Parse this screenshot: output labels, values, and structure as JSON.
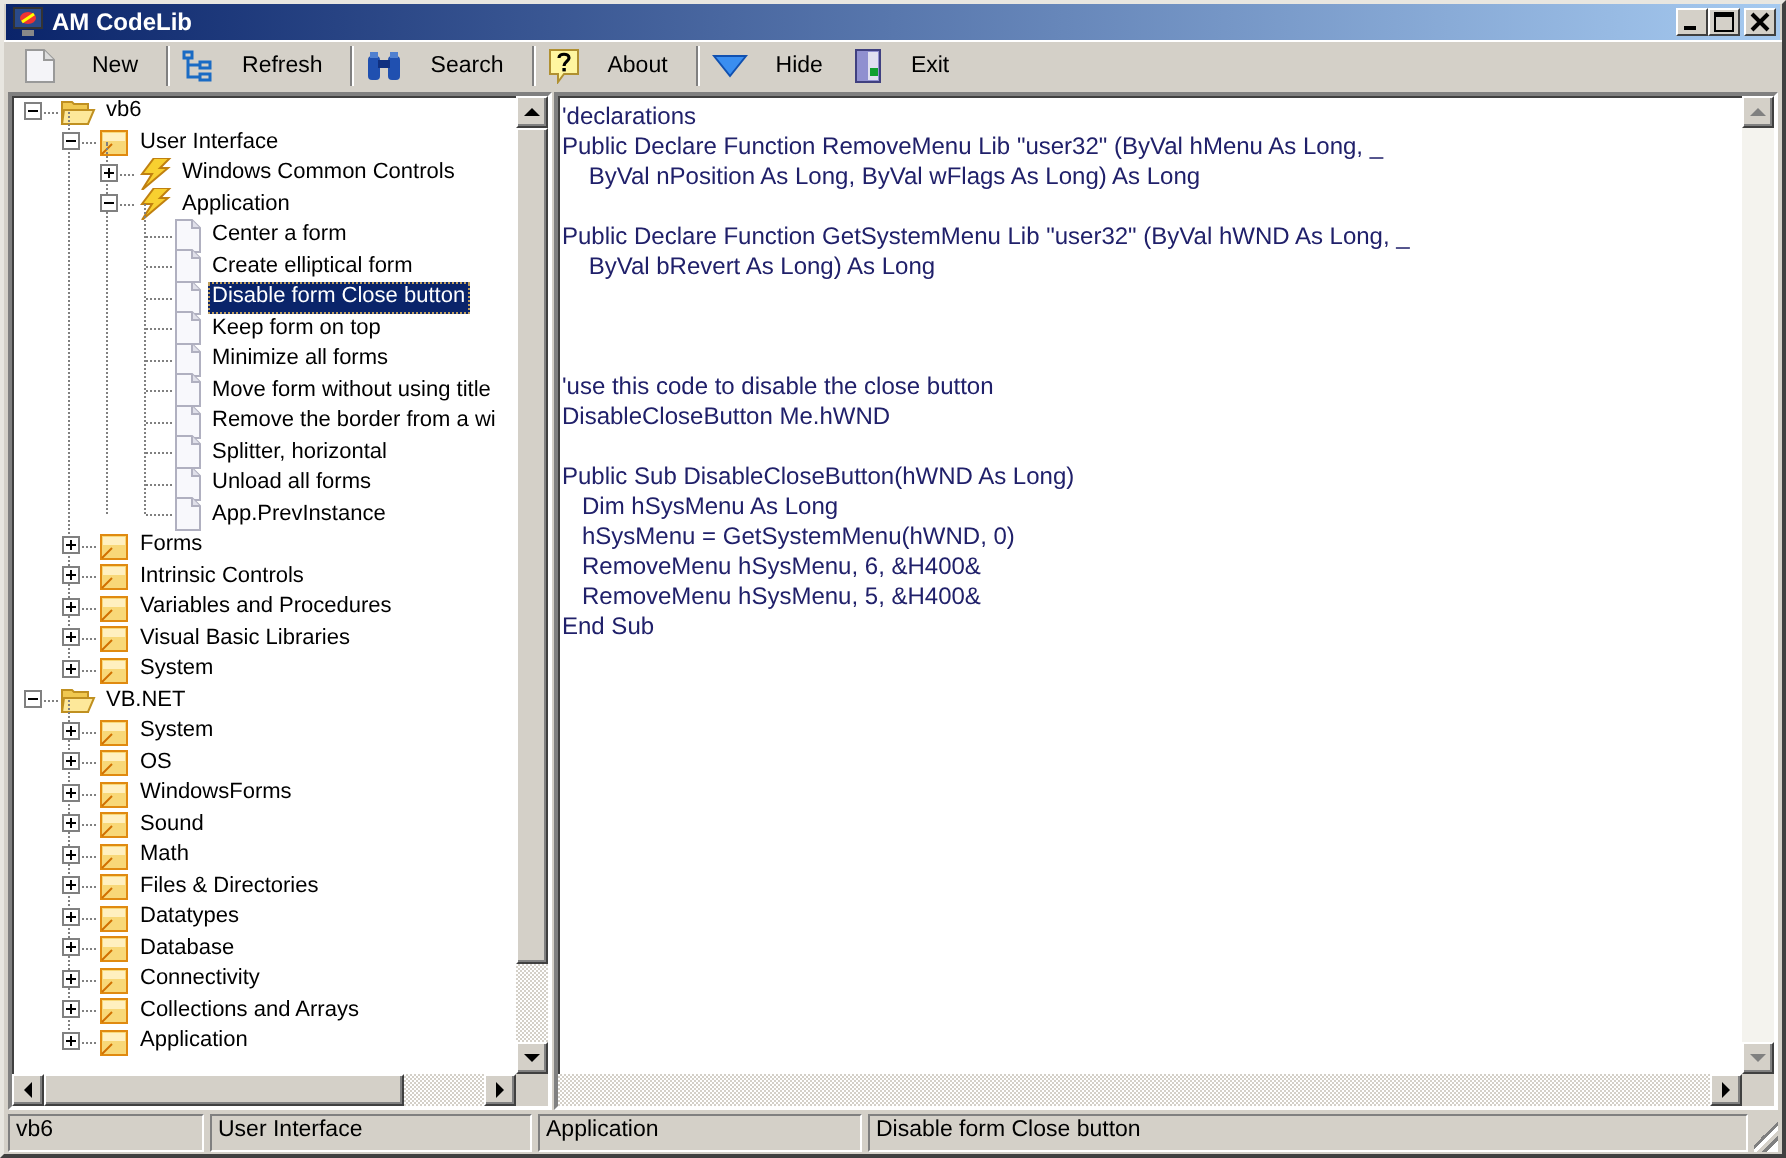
{
  "window": {
    "title": "AM CodeLib"
  },
  "toolbar": [
    [
      {
        "label": "New",
        "kind": "new"
      }
    ],
    [
      {
        "label": "Refresh",
        "kind": "refresh"
      }
    ],
    [
      {
        "label": "Search",
        "kind": "search"
      }
    ],
    [
      {
        "label": "About",
        "kind": "about"
      }
    ],
    [
      {
        "label": "Hide",
        "kind": "hide"
      },
      {
        "label": "Exit",
        "kind": "exit"
      }
    ]
  ],
  "tree": [
    {
      "label": "vb6",
      "kind": "root",
      "expanded": true,
      "selected": false,
      "children": [
        {
          "label": "User Interface",
          "kind": "category",
          "expanded": true,
          "selected": false,
          "children": [
            {
              "label": "Windows Common Controls",
              "kind": "group",
              "expanded": false,
              "selected": false
            },
            {
              "label": "Application",
              "kind": "group",
              "expanded": true,
              "selected": false,
              "children": [
                {
                  "label": "Center a form",
                  "kind": "document",
                  "selected": false
                },
                {
                  "label": "Create elliptical form",
                  "kind": "document",
                  "selected": false
                },
                {
                  "label": "Disable form Close button",
                  "kind": "document",
                  "selected": true
                },
                {
                  "label": "Keep form on top",
                  "kind": "document",
                  "selected": false
                },
                {
                  "label": "Minimize all forms",
                  "kind": "document",
                  "selected": false
                },
                {
                  "label": "Move form without using title",
                  "kind": "document",
                  "selected": false
                },
                {
                  "label": "Remove the border from a wi",
                  "kind": "document",
                  "selected": false
                },
                {
                  "label": "Splitter, horizontal",
                  "kind": "document",
                  "selected": false
                },
                {
                  "label": "Unload all forms",
                  "kind": "document",
                  "selected": false
                },
                {
                  "label": "App.PrevInstance",
                  "kind": "document",
                  "selected": false
                }
              ]
            }
          ]
        },
        {
          "label": "Forms",
          "kind": "category",
          "expanded": false,
          "selected": false
        },
        {
          "label": "Intrinsic Controls",
          "kind": "category",
          "expanded": false,
          "selected": false
        },
        {
          "label": "Variables and Procedures",
          "kind": "category",
          "expanded": false,
          "selected": false
        },
        {
          "label": "Visual Basic Libraries",
          "kind": "category",
          "expanded": false,
          "selected": false
        },
        {
          "label": "System",
          "kind": "category",
          "expanded": false,
          "selected": false
        }
      ]
    },
    {
      "label": "VB.NET",
      "kind": "root",
      "expanded": true,
      "selected": false,
      "children": [
        {
          "label": "System",
          "kind": "category",
          "expanded": false,
          "selected": false
        },
        {
          "label": "OS",
          "kind": "category",
          "expanded": false,
          "selected": false
        },
        {
          "label": "WindowsForms",
          "kind": "category",
          "expanded": false,
          "selected": false
        },
        {
          "label": "Sound",
          "kind": "category",
          "expanded": false,
          "selected": false
        },
        {
          "label": "Math",
          "kind": "category",
          "expanded": false,
          "selected": false
        },
        {
          "label": "Files & Directories",
          "kind": "category",
          "expanded": false,
          "selected": false
        },
        {
          "label": "Datatypes",
          "kind": "category",
          "expanded": false,
          "selected": false
        },
        {
          "label": "Database",
          "kind": "category",
          "expanded": false,
          "selected": false
        },
        {
          "label": "Connectivity",
          "kind": "category",
          "expanded": false,
          "selected": false
        },
        {
          "label": "Collections and Arrays",
          "kind": "category",
          "expanded": false,
          "selected": false
        },
        {
          "label": "Application",
          "kind": "category",
          "expanded": false,
          "selected": false
        }
      ]
    }
  ],
  "code": "'declarations\nPublic Declare Function RemoveMenu Lib \"user32\" (ByVal hMenu As Long, _\n    ByVal nPosition As Long, ByVal wFlags As Long) As Long\n\nPublic Declare Function GetSystemMenu Lib \"user32\" (ByVal hWND As Long, _\n    ByVal bRevert As Long) As Long\n\n\n\n'use this code to disable the close button\nDisableCloseButton Me.hWND\n\nPublic Sub DisableCloseButton(hWND As Long)\n   Dim hSysMenu As Long\n   hSysMenu = GetSystemMenu(hWND, 0)\n   RemoveMenu hSysMenu, 6, &H400&\n   RemoveMenu hSysMenu, 5, &H400&\nEnd Sub",
  "status_bar": [
    "vb6",
    "User Interface",
    "Application",
    "Disable form Close button"
  ]
}
